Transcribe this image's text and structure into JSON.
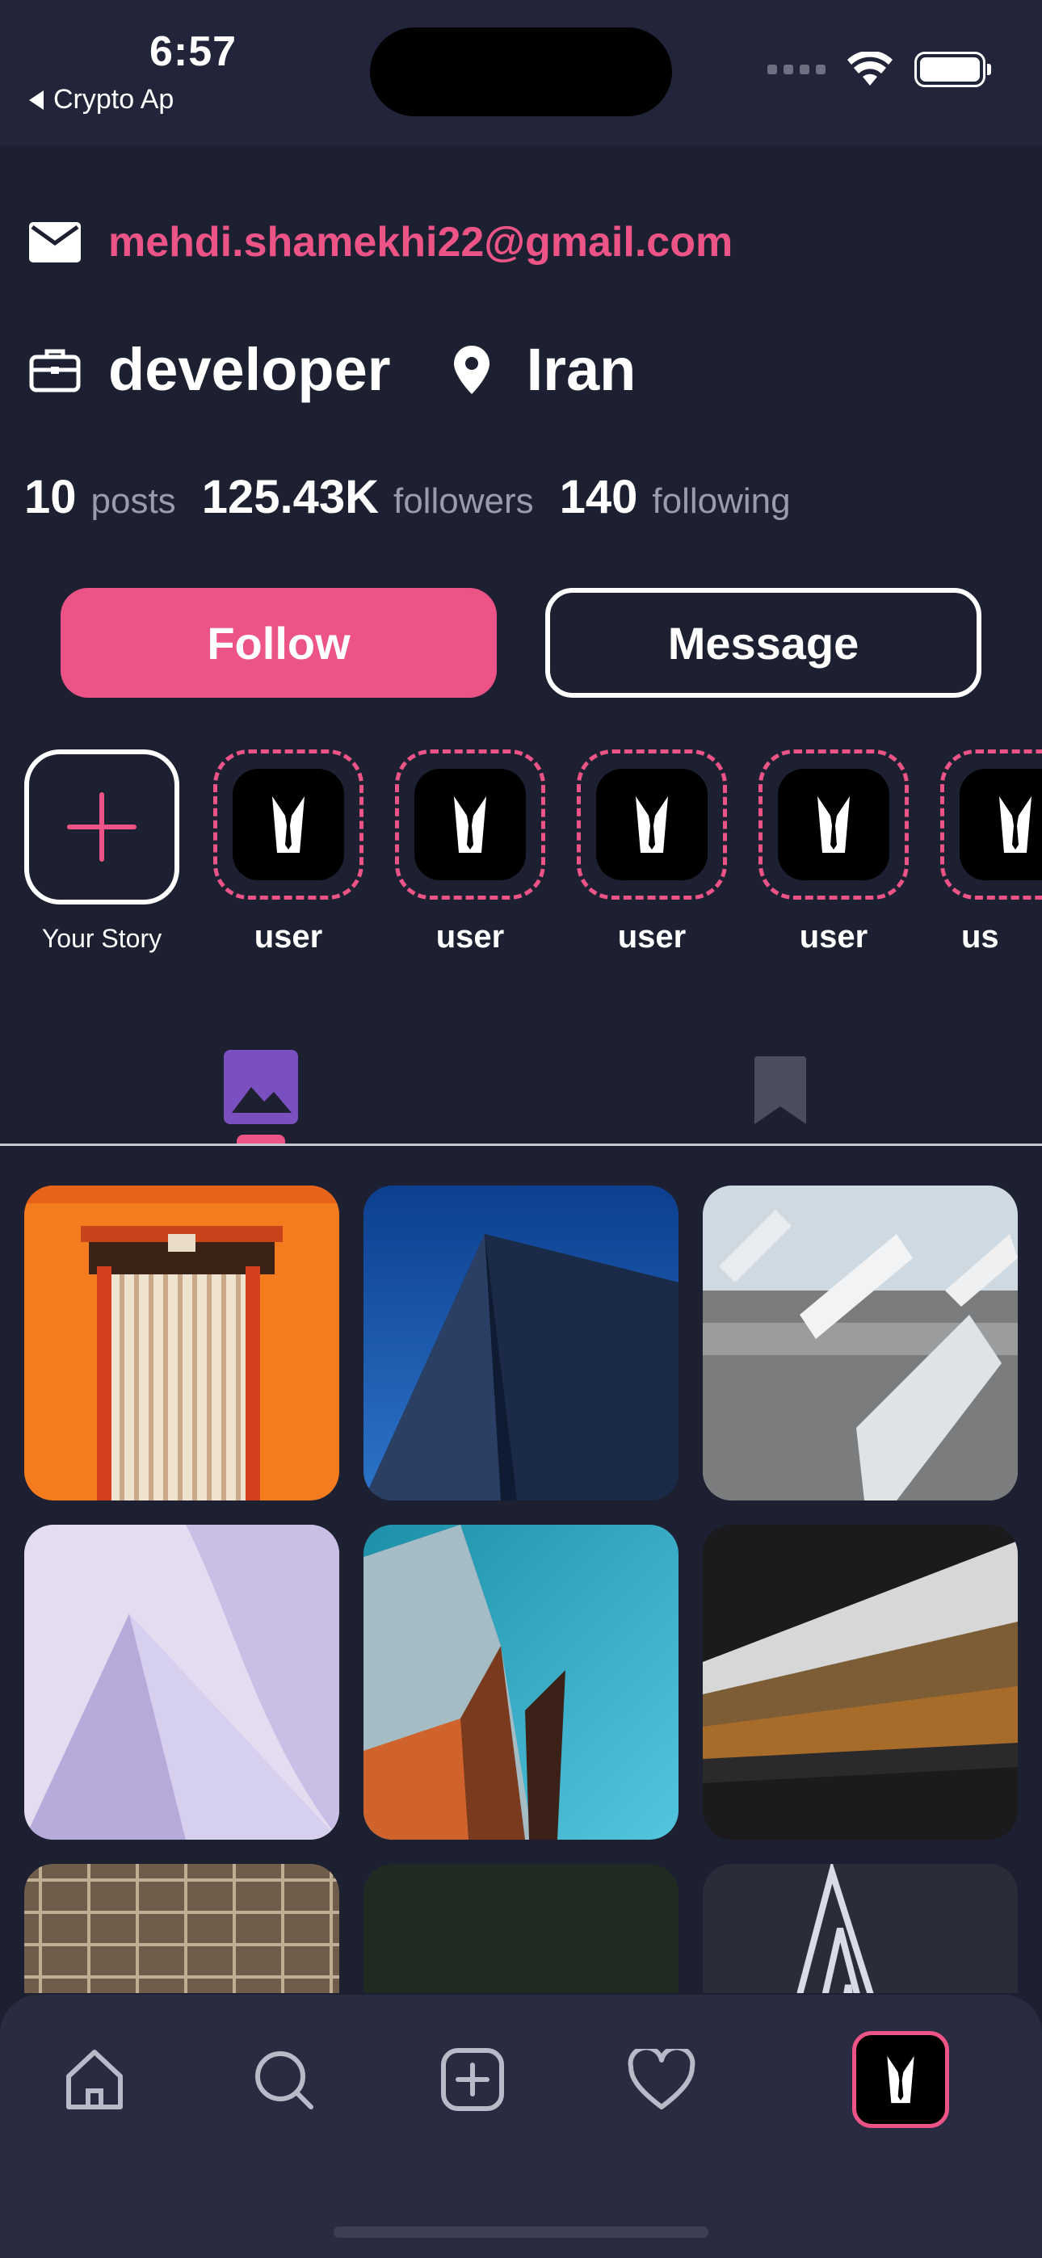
{
  "status_bar": {
    "time": "6:57",
    "back_app_label": "Crypto Ap"
  },
  "profile": {
    "email": "mehdi.shamekhi22@gmail.com",
    "job": "developer",
    "location": "Iran",
    "stats": [
      {
        "value": "10",
        "label": "posts"
      },
      {
        "value": "125.43K",
        "label": "followers"
      },
      {
        "value": "140",
        "label": "following"
      }
    ]
  },
  "actions": {
    "follow_label": "Follow",
    "message_label": "Message"
  },
  "stories": {
    "your_story_label": "Your Story",
    "users": [
      "user",
      "user",
      "user",
      "user",
      "us"
    ]
  },
  "tabs": [
    {
      "name": "posts-tab",
      "icon": "image-icon",
      "active": true
    },
    {
      "name": "saved-tab",
      "icon": "bookmark-icon",
      "active": false
    }
  ],
  "bottom_nav": [
    "home-icon",
    "search-icon",
    "add-post-icon",
    "heart-icon",
    "profile-avatar"
  ],
  "colors": {
    "accent": "#ec5487",
    "background": "#1d2030",
    "nav_background": "#292c41"
  }
}
